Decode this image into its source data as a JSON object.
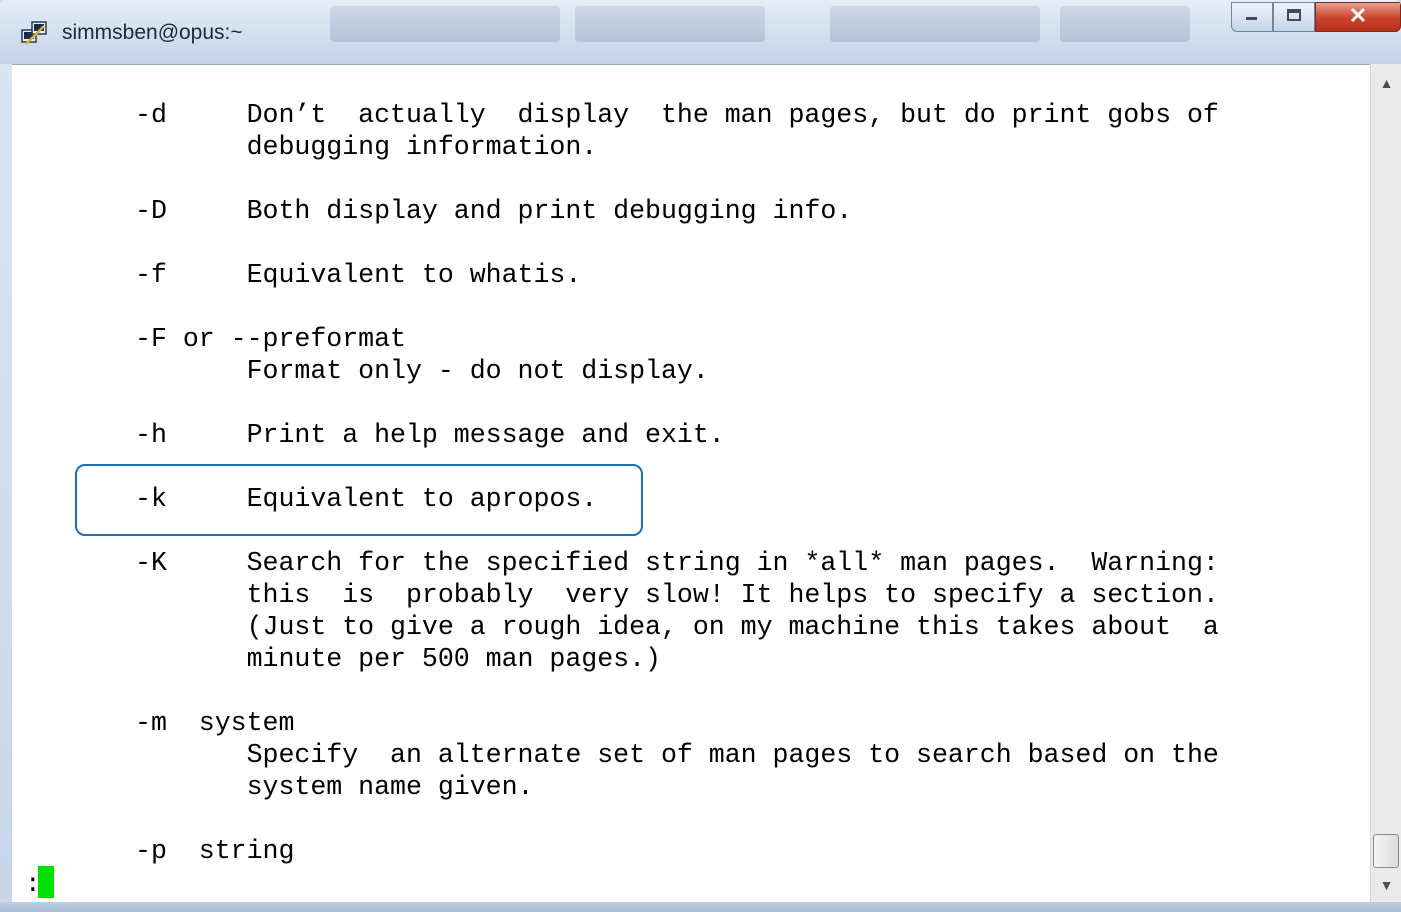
{
  "window": {
    "title": "simmsben@opus:~"
  },
  "man_page": {
    "lines": [
      "-d     Don’t  actually  display  the man pages, but do print gobs of",
      "       debugging information.",
      "",
      "-D     Both display and print debugging info.",
      "",
      "-f     Equivalent to whatis.",
      "",
      "-F or --preformat",
      "       Format only - do not display.",
      "",
      "-h     Print a help message and exit.",
      "",
      "-k     Equivalent to apropos.",
      "",
      "-K     Search for the specified string in *all* man pages.  Warning:",
      "       this  is  probably  very slow! It helps to specify a section.",
      "       (Just to give a rough idea, on my machine this takes about  a",
      "       minute per 500 man pages.)",
      "",
      "-m  system",
      "       Specify  an alternate set of man pages to search based on the",
      "       system name given.",
      "",
      "-p  string"
    ]
  },
  "prompt": {
    "text": ":"
  },
  "colors": {
    "highlight_border": "#1d6fb8",
    "cursor": "#00e000"
  },
  "icons": {
    "app": "putty-icon",
    "minimize": "minimize-icon",
    "maximize": "maximize-icon",
    "close": "close-icon",
    "scroll_up": "scroll-up-arrow-icon",
    "scroll_down": "scroll-down-arrow-icon"
  }
}
